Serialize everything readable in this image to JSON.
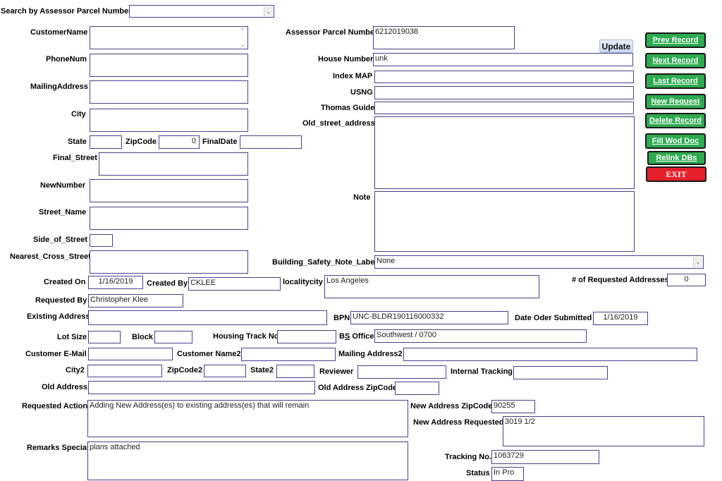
{
  "search": {
    "label": "Search by Assessor Parcel Number:",
    "value": ""
  },
  "buttons": {
    "update": "Update",
    "prev_record": "Prev Record",
    "next_record": "Next Record",
    "last_record": "Last Record",
    "new_request": "New Request",
    "delete_record": "Delete Record",
    "fill_wod_doc": "Fill Wod Doc",
    "relink_dbs": "Relink DBs",
    "exit": "EXIT"
  },
  "colors": {
    "green_button": "#2eaa4f",
    "red_button": "#e3202b",
    "field_border": "#4a3f8c"
  },
  "fields": {
    "customer_name": {
      "label": "CustomerName",
      "value": ""
    },
    "phone_num": {
      "label": "PhoneNum",
      "value": ""
    },
    "mailing_address": {
      "label": "MailingAddress",
      "value": ""
    },
    "city": {
      "label": "City",
      "value": ""
    },
    "state": {
      "label": "State",
      "value": ""
    },
    "zipcode": {
      "label": "ZipCode",
      "value": "0"
    },
    "final_date": {
      "label": "FinalDate",
      "value": ""
    },
    "final_street": {
      "label": "Final_Street",
      "value": ""
    },
    "new_number": {
      "label": "NewNumber",
      "value": ""
    },
    "street_name": {
      "label": "Street_Name",
      "value": ""
    },
    "side_of_street": {
      "label": "Side_of_Street",
      "value": ""
    },
    "nearest_cross_street": {
      "label": "Nearest_Cross_Street",
      "value": ""
    },
    "assessor_parcel_number": {
      "label": "Assessor Parcel Number",
      "value": "6212019038"
    },
    "house_number": {
      "label": "House Number",
      "value": "unk"
    },
    "index_map": {
      "label": "Index MAP",
      "value": ""
    },
    "usng": {
      "label": "USNG",
      "value": ""
    },
    "thomas_guide": {
      "label": "Thomas Guide",
      "value": ""
    },
    "old_street_address": {
      "label": "Old_street_address",
      "value": ""
    },
    "note": {
      "label": "Note",
      "value": ""
    },
    "building_safety_note_label": {
      "label": "Building_Safety_Note_Label",
      "value": "None"
    },
    "created_on": {
      "label": "Created On",
      "value": "1/16/2019"
    },
    "created_by": {
      "label": "Created By",
      "value": "CKLEE"
    },
    "localitycity": {
      "label": "localitycity",
      "value": "Los Angeles"
    },
    "num_requested_addresses": {
      "label": "# of Requested Addresses",
      "value": "0"
    },
    "requested_by": {
      "label": "Requested By",
      "value": "Christopher Klee"
    },
    "existing_address": {
      "label": "Existing Address",
      "value": ""
    },
    "bpn": {
      "label": "BPN",
      "value": "UNC-BLDR190116000332"
    },
    "date_order_submitted": {
      "label": "Date Oder Submitted",
      "value": "1/16/2019"
    },
    "lot_size": {
      "label": "Lot Size",
      "value": ""
    },
    "block": {
      "label": "Block",
      "value": ""
    },
    "housing_track_no": {
      "label": "Housing Track No",
      "value": ""
    },
    "bs_office": {
      "label_b": "B",
      "label_s": "S",
      "label_rest": " Office",
      "value": "Southwest / 0700"
    },
    "customer_email": {
      "label": "Customer E-Mail",
      "value": ""
    },
    "customer_name2": {
      "label": "Customer Name2",
      "value": ""
    },
    "mailing_address2": {
      "label": "Mailing Address2",
      "value": ""
    },
    "city2": {
      "label": "City2",
      "value": ""
    },
    "zipcode2": {
      "label": "ZipCode2",
      "value": ""
    },
    "state2": {
      "label": "State2",
      "value": ""
    },
    "reviewer": {
      "label": "Reviewer",
      "value": ""
    },
    "internal_tracking": {
      "label": "Internal Tracking",
      "value": ""
    },
    "old_address": {
      "label": "Old Address",
      "value": ""
    },
    "old_address_zipcode": {
      "label": "Old Address ZipCode",
      "value": ""
    },
    "requested_action": {
      "label": "Requested Action",
      "value": "Adding New Address(es) to existing address(es) that will remain"
    },
    "new_address_zipcode": {
      "label": "New Address ZipCode",
      "value": "90255"
    },
    "new_address_requested": {
      "label": "New Address Requested",
      "value": "3019 1/2"
    },
    "remarks_special": {
      "label": "Remarks Special",
      "value": "plans attached"
    },
    "tracking_no": {
      "label": "Tracking No.",
      "value": "1063729"
    },
    "status": {
      "label": "Status",
      "value": "In Pro"
    }
  }
}
